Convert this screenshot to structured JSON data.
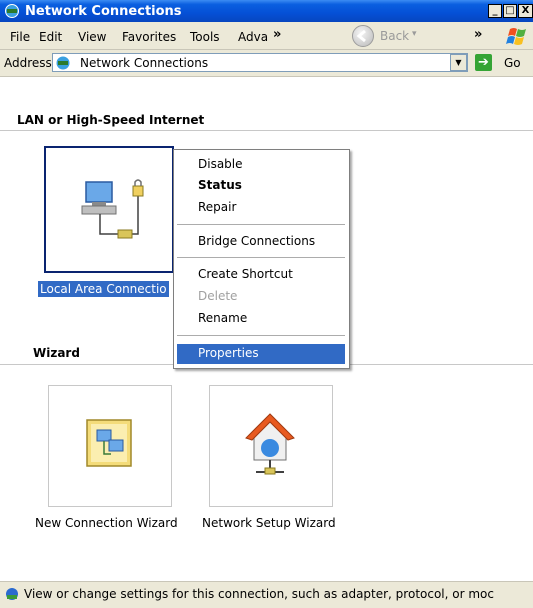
{
  "window": {
    "title": "Network Connections"
  },
  "caption_buttons": {
    "minimize": "_",
    "maximize": "□",
    "close": "X"
  },
  "menu": {
    "items": [
      "File",
      "Edit",
      "View",
      "Favorites",
      "Tools",
      "Adva"
    ],
    "chevron": "»",
    "back_label": "Back",
    "back_dropdown": "▾",
    "chevron2": "»"
  },
  "address": {
    "label": "Address",
    "value": "Network Connections",
    "dropdown": "▼",
    "go_arrow": "➔",
    "go_label": "Go"
  },
  "groups": {
    "lan_title": "LAN or High-Speed Internet",
    "wizard_title": "Wizard"
  },
  "lan_connection": {
    "label": "Local Area Connectio"
  },
  "wizards": [
    {
      "label": "New Connection Wizard"
    },
    {
      "label": "Network Setup Wizard"
    }
  ],
  "context_menu": {
    "items": [
      {
        "label": "Disable",
        "state": "normal"
      },
      {
        "label": "Status",
        "state": "default"
      },
      {
        "label": "Repair",
        "state": "normal"
      },
      {
        "label": "Bridge Connections",
        "state": "normal"
      },
      {
        "label": "Create Shortcut",
        "state": "normal"
      },
      {
        "label": "Delete",
        "state": "disabled"
      },
      {
        "label": "Rename",
        "state": "normal"
      },
      {
        "label": "Properties",
        "state": "highlighted"
      }
    ]
  },
  "status": {
    "text": "View or change settings for this connection, such as adapter, protocol, or moc"
  },
  "colors": {
    "titlebar": "#0550d6",
    "chrome": "#ece9d8",
    "selection": "#316ac5",
    "disabled_text": "#a0a0a0"
  },
  "icons": {
    "title": "network-connections-icon",
    "lan": "lan-connection-icon",
    "new_wizard": "new-connection-wizard-icon",
    "setup_wizard": "network-setup-wizard-icon",
    "status": "network-info-icon"
  }
}
